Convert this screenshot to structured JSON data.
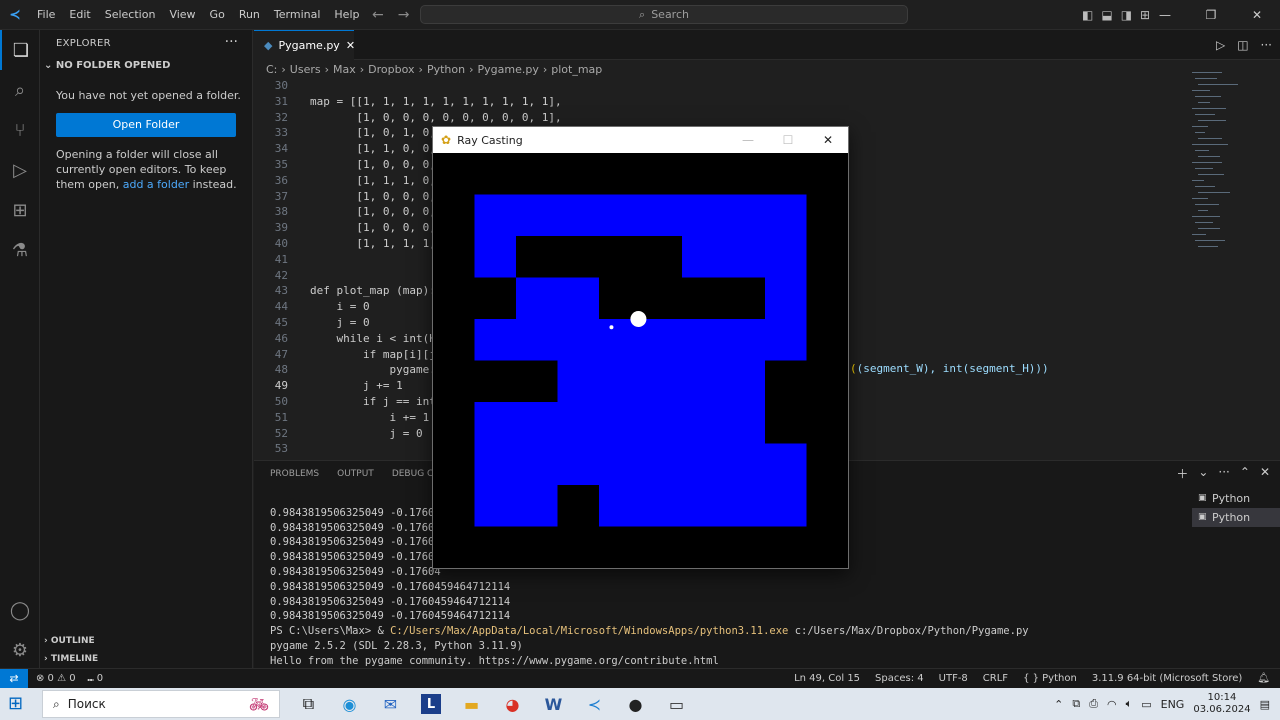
{
  "titlebar": {
    "menu": [
      "File",
      "Edit",
      "Selection",
      "View",
      "Go",
      "Run",
      "Terminal",
      "Help"
    ],
    "search_placeholder": "Search"
  },
  "sidebar": {
    "header": "EXPLORER",
    "section": "NO FOLDER OPENED",
    "message": "You have not yet opened a folder.",
    "open_button": "Open Folder",
    "info_before": "Opening a folder will close all currently open editors. To keep them open, ",
    "info_link": "add a folder",
    "info_after": " instead.",
    "outline": "OUTLINE",
    "timeline": "TIMELINE"
  },
  "editor": {
    "tab_label": "Pygame.py",
    "breadcrumb": [
      "C:",
      "Users",
      "Max",
      "Dropbox",
      "Python",
      "Pygame.py",
      "plot_map"
    ],
    "line_numbers": [
      "30",
      "31",
      "32",
      "33",
      "34",
      "35",
      "36",
      "37",
      "38",
      "39",
      "40",
      "41",
      "42",
      "43",
      "44",
      "45",
      "46",
      "47",
      "48",
      "49",
      "50",
      "51",
      "52",
      "53"
    ],
    "current_line": "49",
    "code_lines": [
      "",
      "map = [[1, 1, 1, 1, 1, 1, 1, 1, 1, 1],",
      "       [1, 0, 0, 0, 0, 0, 0, 0, 0, 1],",
      "       [1, 0, 1, 0,",
      "       [1, 1, 0, 0,",
      "       [1, 0, 0, 0,",
      "       [1, 1, 1, 0,",
      "       [1, 0, 0, 0,",
      "       [1, 0, 0, 0,",
      "       [1, 0, 0, 0,",
      "       [1, 1, 1, 1,",
      "",
      "",
      "def plot_map (map):",
      "    i = 0",
      "    j = 0",
      "    while i < int(H",
      "        if map[i][j",
      "            pygame.",
      "        j += 1",
      "        if j == int",
      "            i += 1",
      "            j = 0",
      ""
    ],
    "line48_tail": "(segment_W), int(segment_H)))"
  },
  "panel": {
    "tabs": [
      "PROBLEMS",
      "OUTPUT",
      "DEBUG CO"
    ],
    "terminal_lines": [
      "0.9843819506325049 -0.17604",
      "0.9843819506325049 -0.17604",
      "0.9843819506325049 -0.17604",
      "0.9843819506325049 -0.17604",
      "0.9843819506325049 -0.17604",
      "0.9843819506325049 -0.1760459464712114",
      "0.9843819506325049 -0.1760459464712114",
      "0.9843819506325049 -0.1760459464712114"
    ],
    "ps_prefix": "PS C:\\Users\\Max> & ",
    "ps_exe": "C:/Users/Max/AppData/Local/Microsoft/WindowsApps/python3.11.exe",
    "ps_arg": " c:/Users/Max/Dropbox/Python/Pygame.py",
    "pygame_line": "pygame 2.5.2 (SDL 2.28.3, Python 3.11.9)",
    "hello_line": "Hello from the pygame community. https://www.pygame.org/contribute.html",
    "terminals": [
      "Python",
      "Python"
    ]
  },
  "status": {
    "problems": "⊗ 0 ⚠ 0",
    "ports": "⑉ 0",
    "position": "Ln 49, Col 15",
    "spaces": "Spaces: 4",
    "encoding": "UTF-8",
    "eol": "CRLF",
    "language": "Python",
    "interpreter": "3.11.9 64-bit (Microsoft Store)"
  },
  "pygame_window": {
    "title": "Ray Casting",
    "grid": [
      [
        1,
        1,
        1,
        1,
        1,
        1,
        1,
        1,
        1,
        1
      ],
      [
        1,
        0,
        0,
        0,
        0,
        0,
        0,
        0,
        0,
        1
      ],
      [
        1,
        0,
        1,
        1,
        1,
        1,
        0,
        0,
        0,
        1
      ],
      [
        1,
        1,
        0,
        0,
        1,
        1,
        1,
        1,
        0,
        1
      ],
      [
        1,
        0,
        0,
        0,
        0,
        0,
        0,
        0,
        0,
        1
      ],
      [
        1,
        1,
        1,
        0,
        0,
        0,
        0,
        0,
        1,
        1
      ],
      [
        1,
        0,
        0,
        0,
        0,
        0,
        0,
        0,
        1,
        1
      ],
      [
        1,
        0,
        0,
        0,
        0,
        0,
        0,
        0,
        0,
        1
      ],
      [
        1,
        0,
        0,
        1,
        0,
        0,
        0,
        0,
        0,
        1
      ],
      [
        1,
        1,
        1,
        1,
        1,
        1,
        1,
        1,
        1,
        1
      ]
    ],
    "wall_color": "#000000",
    "floor_color": "#0000ff",
    "player_col": 4.95,
    "player_row": 4.0,
    "ray_tip_col": 4.3,
    "ray_tip_row": 4.2
  },
  "taskbar": {
    "search_placeholder": "Поиск",
    "language": "ENG",
    "time": "10:14",
    "date": "03.06.2024"
  }
}
